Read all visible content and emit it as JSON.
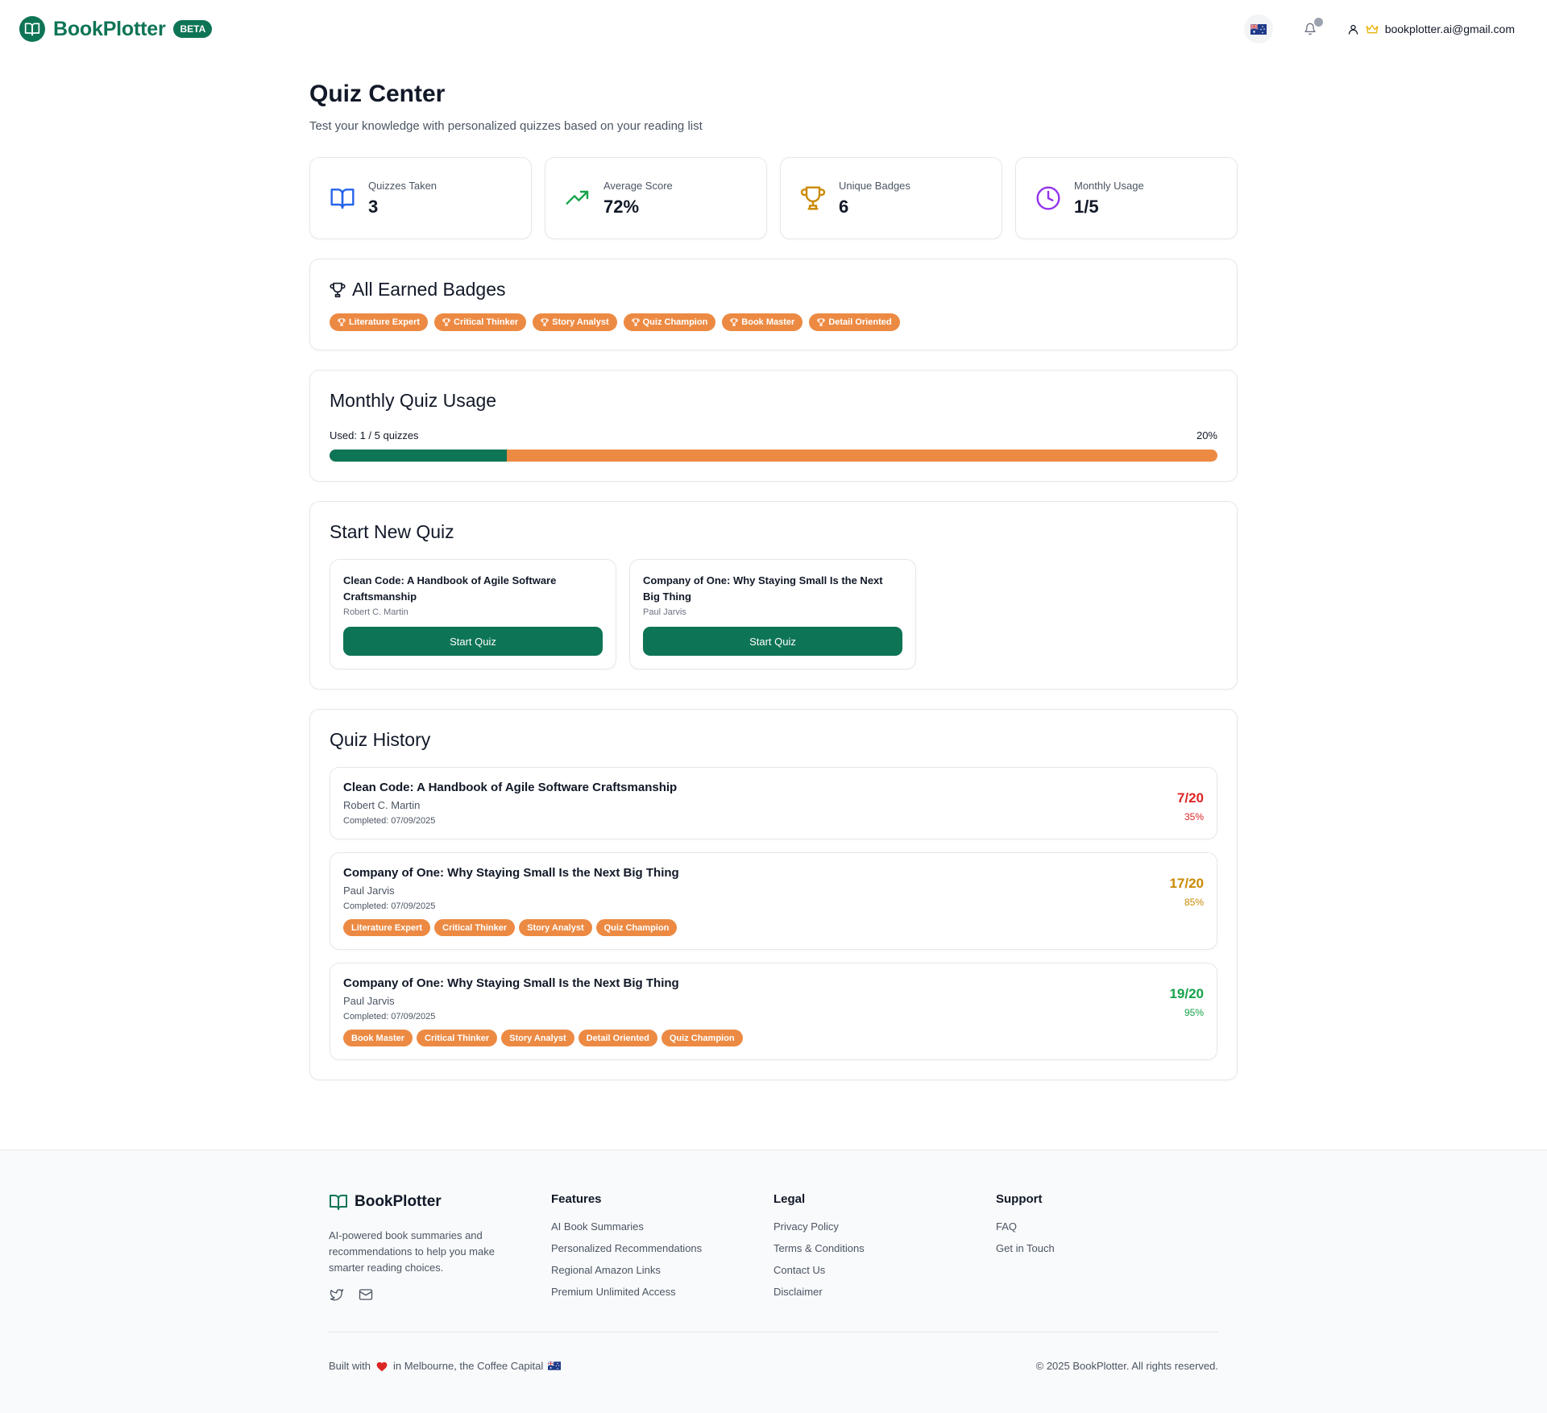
{
  "header": {
    "brand": "BookPlotter",
    "beta": "BETA",
    "user_email": "bookplotter.ai@gmail.com"
  },
  "page": {
    "title": "Quiz Center",
    "subtitle": "Test your knowledge with personalized quizzes based on your reading list"
  },
  "stats": [
    {
      "label": "Quizzes Taken",
      "value": "3",
      "icon": "book-open-icon",
      "color": "#2563eb"
    },
    {
      "label": "Average Score",
      "value": "72%",
      "icon": "trending-up-icon",
      "color": "#16a34a"
    },
    {
      "label": "Unique Badges",
      "value": "6",
      "icon": "trophy-icon",
      "color": "#ca8a04"
    },
    {
      "label": "Monthly Usage",
      "value": "1/5",
      "icon": "clock-icon",
      "color": "#9333ea"
    }
  ],
  "badges_card": {
    "title": "All Earned Badges",
    "badges": [
      "Literature Expert",
      "Critical Thinker",
      "Story Analyst",
      "Quiz Champion",
      "Book Master",
      "Detail Oriented"
    ]
  },
  "usage": {
    "title": "Monthly Quiz Usage",
    "used_label": "Used: 1 / 5 quizzes",
    "percent_label": "20%",
    "fraction": 0.2
  },
  "start_quiz": {
    "title": "Start New Quiz",
    "quizzes": [
      {
        "title": "Clean Code: A Handbook of Agile Software Craftsmanship",
        "author": "Robert C. Martin",
        "button": "Start Quiz"
      },
      {
        "title": "Company of One: Why Staying Small Is the Next Big Thing",
        "author": "Paul Jarvis",
        "button": "Start Quiz"
      }
    ]
  },
  "history": {
    "title": "Quiz History",
    "items": [
      {
        "title": "Clean Code: A Handbook of Agile Software Craftsmanship",
        "author": "Robert C. Martin",
        "completed": "Completed: 07/09/2025",
        "score": "7/20",
        "percent": "35%",
        "color": "#dc2626",
        "badges": []
      },
      {
        "title": "Company of One: Why Staying Small Is the Next Big Thing",
        "author": "Paul Jarvis",
        "completed": "Completed: 07/09/2025",
        "score": "17/20",
        "percent": "85%",
        "color": "#ca8a04",
        "badges": [
          "Literature Expert",
          "Critical Thinker",
          "Story Analyst",
          "Quiz Champion"
        ]
      },
      {
        "title": "Company of One: Why Staying Small Is the Next Big Thing",
        "author": "Paul Jarvis",
        "completed": "Completed: 07/09/2025",
        "score": "19/20",
        "percent": "95%",
        "color": "#16a34a",
        "badges": [
          "Book Master",
          "Critical Thinker",
          "Story Analyst",
          "Detail Oriented",
          "Quiz Champion"
        ]
      }
    ]
  },
  "footer": {
    "brand": "BookPlotter",
    "description": "AI-powered book summaries and recommendations to help you make smarter reading choices.",
    "columns": [
      {
        "heading": "Features",
        "links": [
          "AI Book Summaries",
          "Personalized Recommendations",
          "Regional Amazon Links",
          "Premium Unlimited Access"
        ]
      },
      {
        "heading": "Legal",
        "links": [
          "Privacy Policy",
          "Terms & Conditions",
          "Contact Us",
          "Disclaimer"
        ]
      },
      {
        "heading": "Support",
        "links": [
          "FAQ",
          "Get in Touch"
        ]
      }
    ],
    "built_prefix": "Built with",
    "built_suffix": "in Melbourne, the Coffee Capital",
    "copyright": "© 2025 BookPlotter. All rights reserved."
  },
  "colors": {
    "brand": "#0e7456",
    "badge": "#ec8a43"
  }
}
